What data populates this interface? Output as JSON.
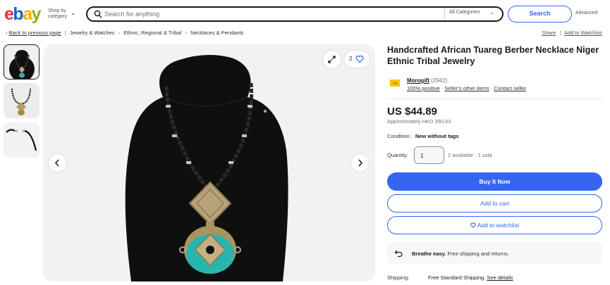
{
  "header": {
    "logo_letters": [
      "e",
      "b",
      "a",
      "y"
    ],
    "shop_by_category": "Shop by category",
    "search_placeholder": "Search for anything",
    "category_select": "All Categories",
    "search_button": "Search",
    "advanced_link": "Advanced"
  },
  "breadcrumb": {
    "back": "Back to previous page",
    "items": [
      "Jewelry & Watches",
      "Ethnic, Regional & Tribal",
      "Necklaces & Pendants"
    ]
  },
  "actions": {
    "share": "Share",
    "add_to_watchlist": "Add to Watchlist"
  },
  "gallery": {
    "watch_count": "2"
  },
  "listing": {
    "title": "Handcrafted African Tuareg Berber Necklace Niger Ethnic Tribal Jewelry",
    "seller": {
      "name": "Morogift",
      "feedback_count": "(2942)",
      "positive": "100% positive",
      "other_items": "Seller's other items",
      "contact": "Contact seller"
    },
    "price": "US $44.89",
    "approx_price": "Approximately HKD 350.63",
    "condition_label": "Condition:",
    "condition_value": "New without tags",
    "quantity_label": "Quantity:",
    "quantity_value": "1",
    "availability": "2 available · 1 sold",
    "buy_now": "Buy It Now",
    "add_to_cart": "Add to cart",
    "add_to_watchlist": "Add to watchlist",
    "breathe_bold": "Breathe easy.",
    "breathe_text": " Free shipping and returns.",
    "shipping_label": "Shipping:",
    "shipping_value": "Free Standard Shipping.",
    "see_details": "See details"
  },
  "colors": {
    "accent": "#3665f3",
    "logo_e": "#e53238",
    "logo_b": "#0064d2",
    "logo_a": "#f5af02",
    "logo_y": "#86b817"
  }
}
